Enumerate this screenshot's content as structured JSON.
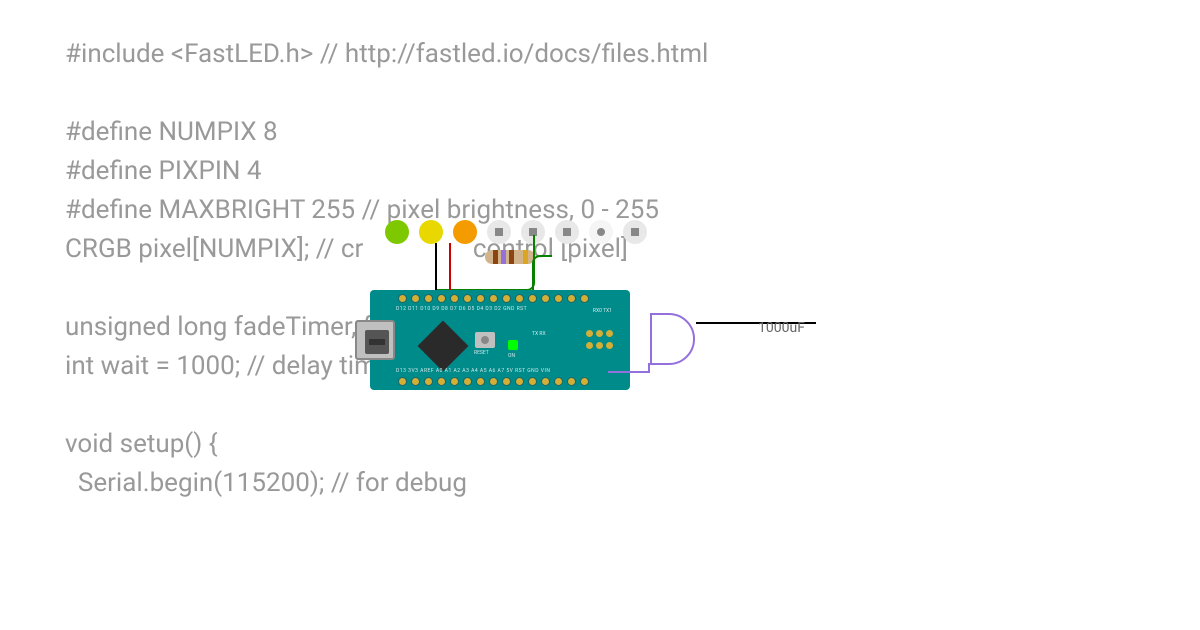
{
  "code": {
    "line1": "#include <FastLED.h> // http://fastled.io/docs/files.html",
    "line2": "",
    "line3": "#define NUMPIX 8",
    "line4": "#define PIXPIN 4",
    "line5": "#define MAXBRIGHT 255 // pixel brightness, 0 - 255",
    "line6": "CRGB pixel[NUMPIX]; // cr                 control [pixel]",
    "line7": "",
    "line8": "unsigned long fadeTimer, fadeTimeout = 250;",
    "line9": "int wait = 1000; // delay time",
    "line10": "",
    "line11": "void setup() {",
    "line12": "  Serial.begin(115200); // for debug"
  },
  "board": {
    "pins_top": "D12 D11 D10 D9 D8 D7 D6 D5 D4 D3 D2 GND RST",
    "pins_bottom": "D13 3V3 AREF A0  A1  A2  A3  A4  A5  A6  A7  5V  RST GND VIN",
    "reset": "RESET",
    "on": "ON",
    "txrx": "TX\nRX",
    "rx0tx1": "RX0 TX1"
  },
  "component": {
    "capacitor_label": "1000uF"
  }
}
